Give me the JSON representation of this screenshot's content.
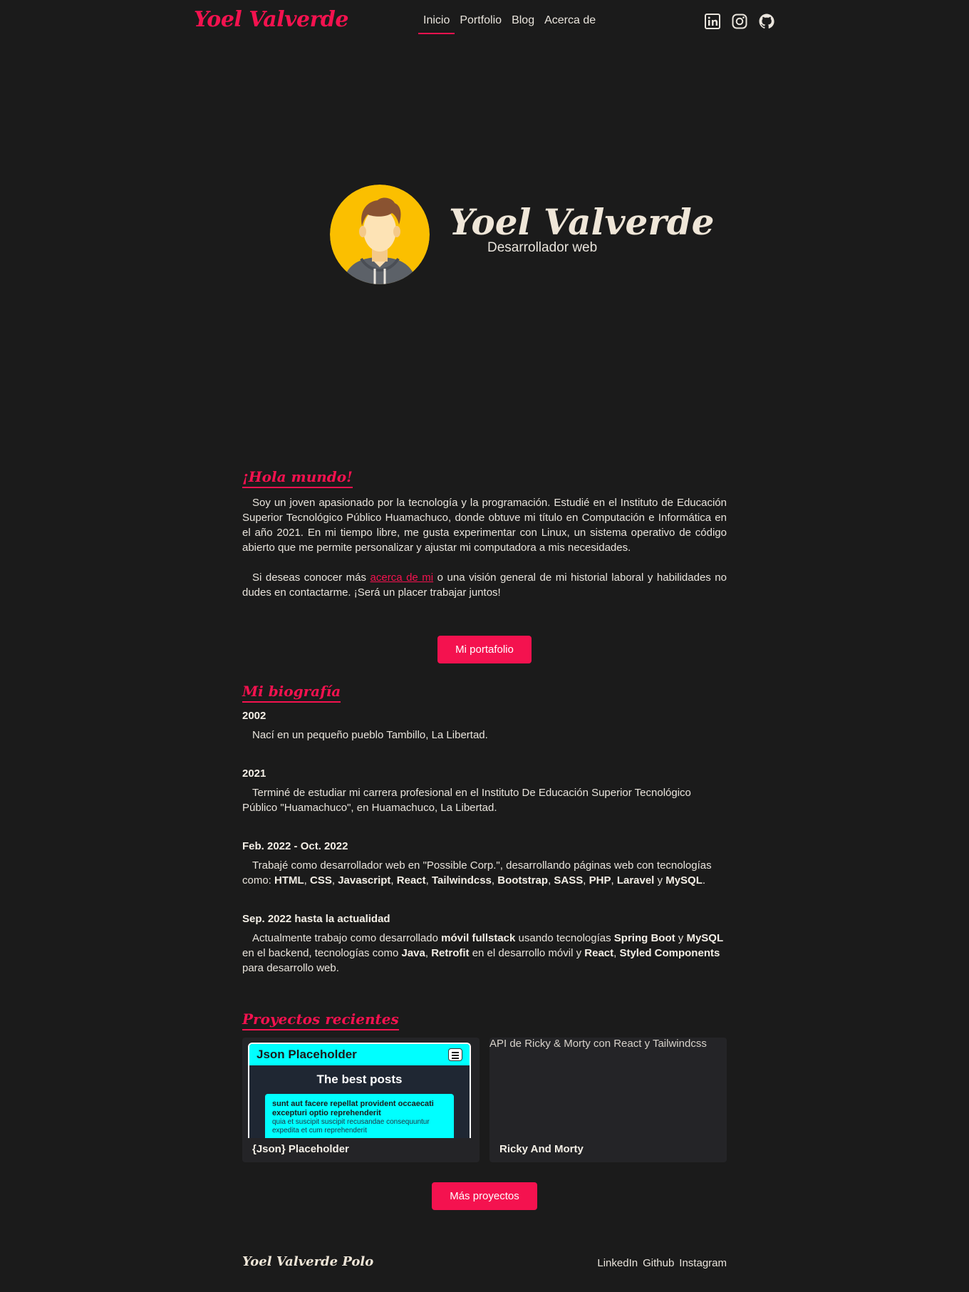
{
  "nav": {
    "logo": "Yoel Valverde",
    "items": [
      {
        "label": "Inicio",
        "active": true
      },
      {
        "label": "Portfolio"
      },
      {
        "label": "Blog"
      },
      {
        "label": "Acerca de"
      }
    ],
    "socials": [
      "linkedin-icon",
      "instagram-icon",
      "github-icon"
    ]
  },
  "hero": {
    "name": "Yoel Valverde",
    "role": "Desarrollador web"
  },
  "hello": {
    "title": "¡Hola mundo!",
    "paragraph1": "Soy un joven apasionado por la tecnología y la programación. Estudié en el Instituto de Educación Superior Tecnológico Público Huamachuco, donde obtuve mi título en Computación e Informática en el año 2021. En mi tiempo libre, me gusta experimentar con Linux, un sistema operativo de código abierto que me permite personalizar y ajustar mi computadora a mis necesidades.",
    "p2_before": "Si deseas conocer más ",
    "p2_link": "acerca de mi",
    "p2_after": " o una visión general de mi historial laboral y habilidades no dudes en contactarme. ¡Será un placer trabajar juntos!",
    "button": "Mi portafolio"
  },
  "bio": {
    "title": "Mi biografía",
    "y1": "2002",
    "t1": "Nací en un pequeño pueblo Tambillo, La Libertad.",
    "y2": "2021",
    "t2": "Terminé de estudiar mi carrera profesional en el Instituto De Educación Superior Tecnológico Público \"Huamachuco\", en Huamachuco, La Libertad.",
    "y3": "Feb. 2022 - Oct. 2022",
    "t3a": "Trabajé como desarrollador web en \"Possible Corp.\", desarrollando páginas web con tecnologías como: ",
    "techs": [
      "HTML",
      "CSS",
      "Javascript",
      "React",
      "Tailwindcss",
      "Bootstrap",
      "SASS",
      "PHP",
      "Laravel"
    ],
    "t3and": " y ",
    "t3last": "MySQL",
    "y4": "Sep. 2022 hasta la actualidad",
    "t4_1": "Actualmente trabajo como desarrollado ",
    "t4_b1": "móvil fullstack",
    "t4_2": " usando tecnologías ",
    "t4_b2": "Spring Boot",
    "t4_3": " y ",
    "t4_b3": "MySQL",
    "t4_4": " en el backend, tecnologías como ",
    "t4_b4": "Java",
    "t4_5": ", ",
    "t4_b5": "Retrofit",
    "t4_6": " en el desarrollo móvil y ",
    "t4_b6": "React",
    "t4_7": ", ",
    "t4_b7": "Styled Components",
    "t4_8": " para desarrollo web."
  },
  "projects": {
    "title": "Proyectos recientes",
    "card1": {
      "title": "{Json} Placeholder",
      "mock_header": "Json Placeholder",
      "mock_heading": "The best posts",
      "mock_post_title": "sunt aut facere repellat provident occaecati excepturi optio reprehenderit",
      "mock_post_body": "quia et suscipit suscipit recusandae consequuntur expedita et cum reprehenderit"
    },
    "card2": {
      "title": "Ricky And Morty",
      "alt": "API de Ricky & Morty con React y Tailwindcss"
    },
    "button": "Más proyectos"
  },
  "footer": {
    "name": "Yoel Valverde Polo",
    "links": [
      "LinkedIn",
      "Github",
      "Instagram"
    ]
  },
  "colors": {
    "accent": "#f4124f",
    "background": "#1b1b1b",
    "avatar_bg": "#fbbf00",
    "mock_cyan": "#00ffff"
  }
}
